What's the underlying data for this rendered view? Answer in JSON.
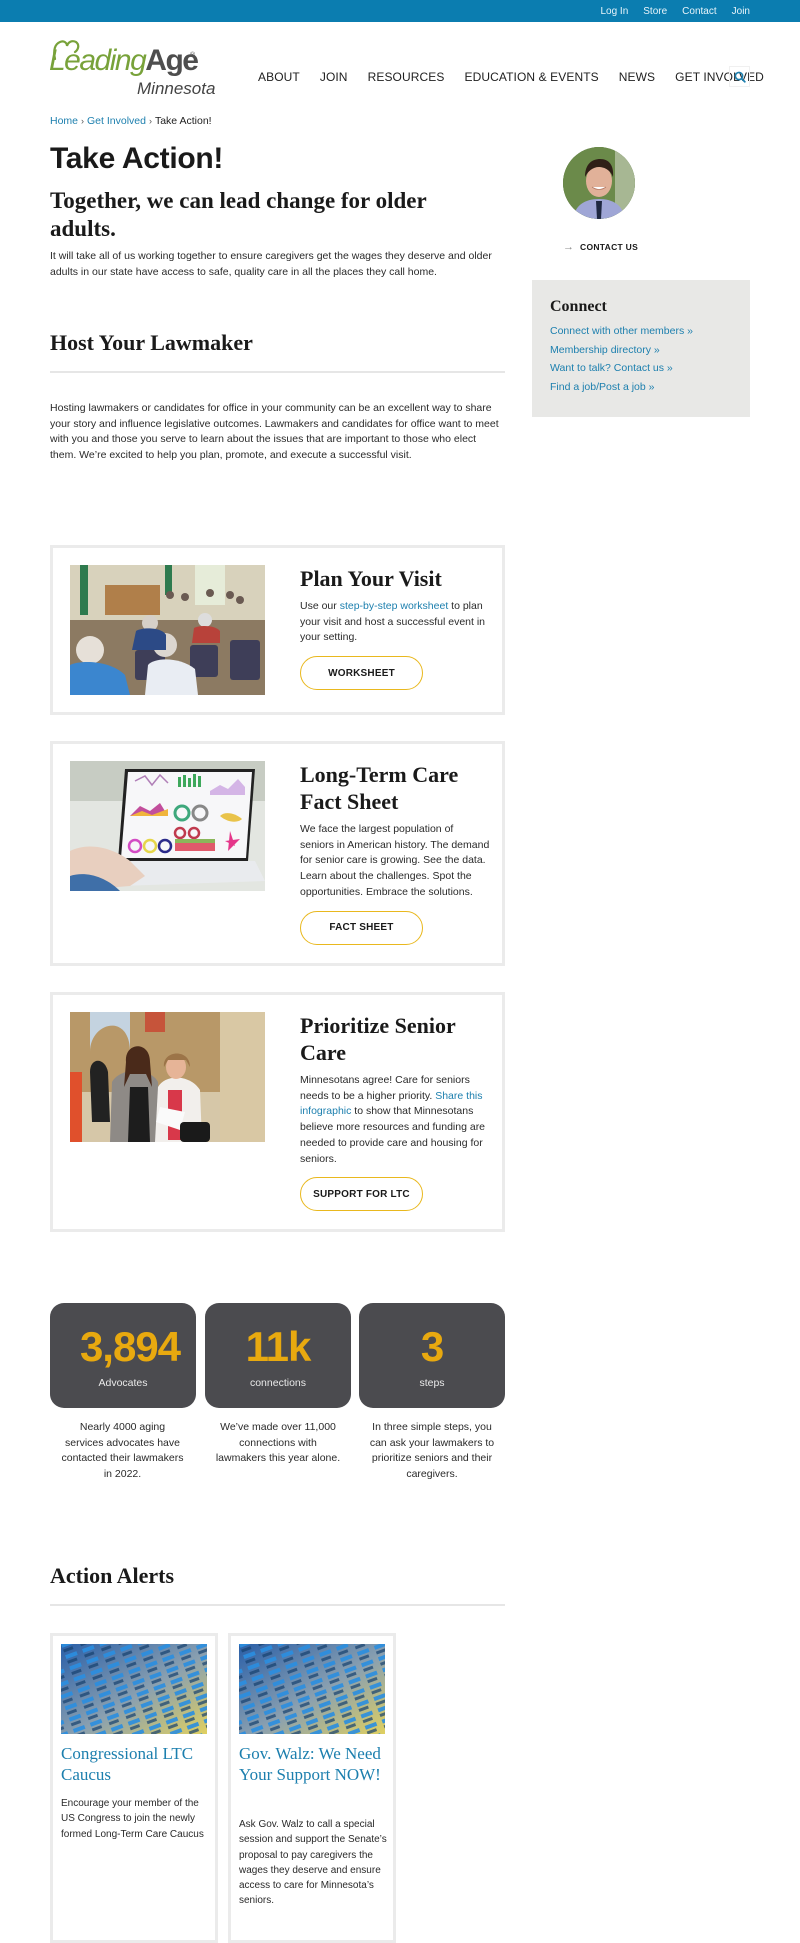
{
  "topbar": {
    "links": [
      "Log In",
      "Store",
      "Contact",
      "Join"
    ]
  },
  "header": {
    "logo": {
      "leading": "Leading",
      "age": "Age",
      "registered": "®",
      "subtitle": "Minnesota"
    },
    "nav": [
      "ABOUT",
      "JOIN",
      "RESOURCES",
      "EDUCATION & EVENTS",
      "NEWS",
      "GET INVOLVED"
    ],
    "search_icon": "search-icon"
  },
  "breadcrumb": {
    "items": [
      "Home",
      "Get Involved"
    ],
    "separator": "›",
    "current": "Take Action!"
  },
  "page": {
    "title": "Take Action!",
    "subtitle": "Together, we can lead change for older adults.",
    "intro": "It will take all of us working together to ensure caregivers get the wages they deserve and older adults in our state have access to safe, quality care in all the places they call home."
  },
  "host": {
    "heading": "Host Your Lawmaker",
    "text": "Hosting lawmakers or candidates for office in your community can be an excellent way to share your story and influence legislative outcomes. Lawmakers and candidates for office want to meet with you and those you serve to learn about the issues that are important to those who elect them. We’re excited to help you plan, promote, and execute a successful visit."
  },
  "sidebar": {
    "contact_label": "CONTACT US",
    "connect": {
      "title": "Connect",
      "links": [
        "Connect with other members »",
        "Membership directory »",
        "Want to talk? Contact us »",
        "Find a job/Post a job »"
      ]
    }
  },
  "cards": [
    {
      "title": "Plan Your Visit",
      "text_before": "Use our ",
      "link": "step-by-step worksheet",
      "text_after": " to plan your visit and host a successful event in your setting.",
      "button": "WORKSHEET"
    },
    {
      "title": "Long-Term Care Fact Sheet",
      "text_before": "We face the largest population of seniors in American history. The demand for senior care is growing. See the data. Learn about the challenges. Spot the opportunities. Embrace the solutions.",
      "link": "",
      "text_after": "",
      "button": "FACT SHEET"
    },
    {
      "title": "Prioritize Senior Care",
      "text_before": "Minnesotans agree! Care for seniors needs to be a higher priority. ",
      "link": "Share this infographic",
      "text_after": " to show that Minnesotans believe more resources and funding are needed to provide care and housing for seniors.",
      "button": "SUPPORT FOR LTC"
    }
  ],
  "stats": [
    {
      "number": "3,894",
      "label": "Advocates",
      "description": "Nearly 4000 aging services advocates have contacted their lawmakers in 2022."
    },
    {
      "number": "11k",
      "label": "connections",
      "description": "We’ve made over 11,000 connections with lawmakers this year alone."
    },
    {
      "number": "3",
      "label": "steps",
      "description": "In three simple steps, you can ask your lawmakers to prioritize seniors and their caregivers."
    }
  ],
  "alerts": {
    "heading": "Action Alerts",
    "items": [
      {
        "title": "Congressional LTC Caucus",
        "text": "Encourage your member of the US Congress to join the newly formed Long-Term Care Caucus"
      },
      {
        "title": "Gov. Walz: We Need Your Support NOW!",
        "text": "Ask Gov. Walz to call a special session and support the Senate’s proposal to pay caregivers the wages they deserve and ensure access to care for Minnesota’s seniors."
      }
    ]
  },
  "colors": {
    "topbar": "#0b7db0",
    "link": "#1c7fae",
    "accent_gold": "#e8a90f",
    "button_border": "#e9b81e",
    "stat_bg": "#4b4b4f",
    "logo_green": "#78a23a",
    "connect_bg": "#e8e8e6"
  }
}
